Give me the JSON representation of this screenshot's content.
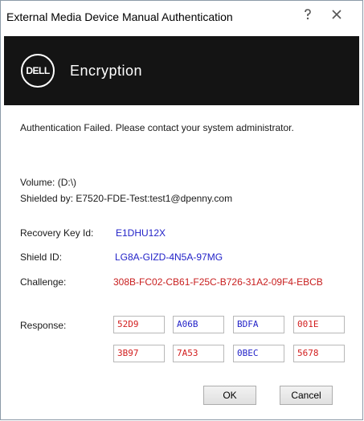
{
  "window": {
    "title": "External Media Device Manual Authentication",
    "help_icon": "help-icon",
    "close_icon": "close-icon"
  },
  "banner": {
    "logo_text": "DELL",
    "product": "Encryption",
    "background": "#141414"
  },
  "status": {
    "message": "Authentication Failed. Please contact your system administrator."
  },
  "info": {
    "volume": "Volume:  (D:\\)",
    "shielded_by": "Shielded by: E7520-FDE-Test:test1@dpenny.com"
  },
  "recovery": {
    "key_id_label": "Recovery Key Id:",
    "key_id_value": "E1DHU12X",
    "shield_id_label": "Shield ID:",
    "shield_id_value": "LG8A-GIZD-4N5A-97MG",
    "challenge_label": "Challenge:",
    "challenge_value": "308B-FC02-CB61-F25C-B726-31A2-09F4-EBCB"
  },
  "response": {
    "label": "Response:",
    "fields": [
      "52D9",
      "A06B",
      "BDFA",
      "001E",
      "3B97",
      "7A53",
      "0BEC",
      "5678"
    ]
  },
  "buttons": {
    "ok": "OK",
    "cancel": "Cancel"
  },
  "colors": {
    "blue": "#2323c8",
    "red": "#d21e1e"
  }
}
